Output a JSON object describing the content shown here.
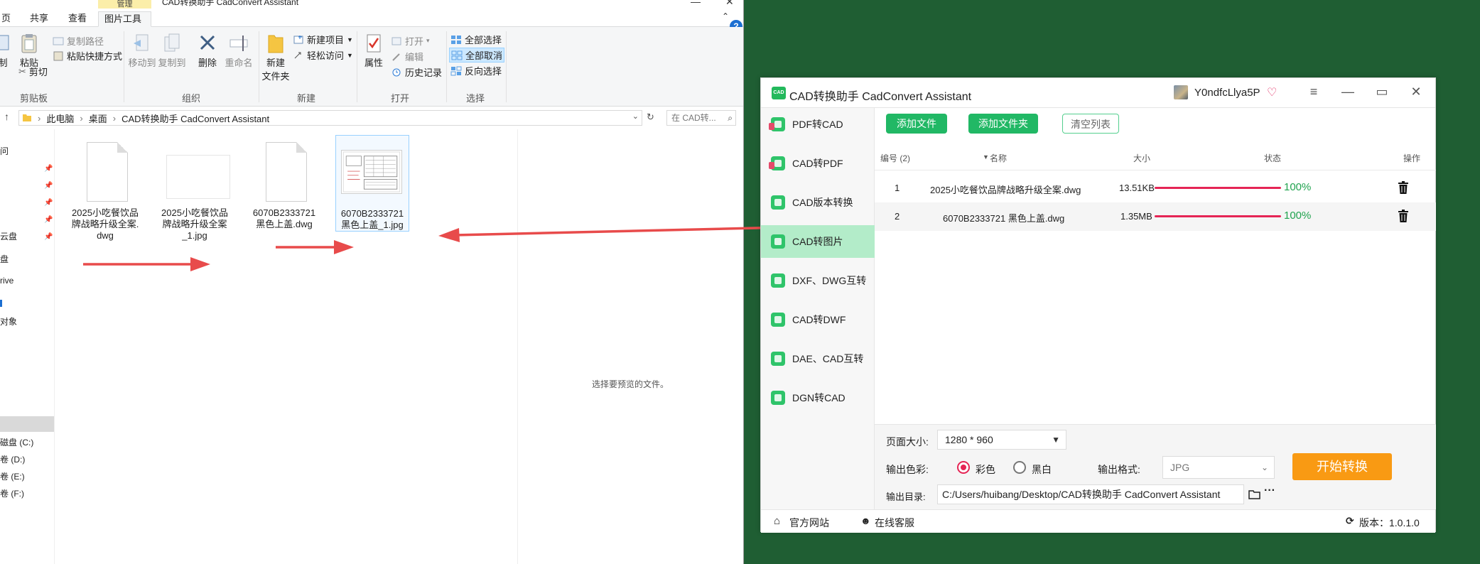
{
  "explorer": {
    "window_title": "CAD转换助手 CadConvert Assistant",
    "context_tab_header": "管理",
    "tabs": [
      "页",
      "共享",
      "查看",
      "图片工具"
    ],
    "ribbon": {
      "clipboard": {
        "copy_cut_partial": "制",
        "paste": "粘贴",
        "copy_path": "复制路径",
        "paste_shortcut": "粘贴快捷方式",
        "cut": "剪切",
        "group": "剪贴板"
      },
      "organize": {
        "move_to": "移动到",
        "copy_to": "复制到",
        "delete": "删除",
        "rename": "重命名",
        "group": "组织"
      },
      "new": {
        "new_folder_l1": "新建",
        "new_folder_l2": "文件夹",
        "new_item": "新建项目",
        "easy_access": "轻松访问",
        "group": "新建"
      },
      "open": {
        "properties": "属性",
        "open": "打开",
        "edit": "编辑",
        "history": "历史记录",
        "group": "打开"
      },
      "select": {
        "select_all": "全部选择",
        "select_none": "全部取消",
        "invert": "反向选择",
        "group": "选择"
      }
    },
    "address": {
      "crumb1": "此电脑",
      "crumb2": "桌面",
      "crumb3": "CAD转换助手 CadConvert Assistant"
    },
    "search_placeholder": "在 CAD转...",
    "nav_items": [
      "问",
      "云盘",
      "盘",
      "rive",
      "",
      "对象",
      "磁盘 (C:)",
      "卷 (D:)",
      "卷 (E:)",
      "卷 (F:)"
    ],
    "files": [
      {
        "l1": "2025小吃餐饮品",
        "l2": "牌战略升级全案.",
        "l3": "dwg"
      },
      {
        "l1": "2025小吃餐饮品",
        "l2": "牌战略升级全案",
        "l3": "_1.jpg"
      },
      {
        "l1": "6070B2333721",
        "l2": "黑色上盖.dwg",
        "l3": ""
      },
      {
        "l1": "6070B2333721",
        "l2": "黑色上盖_1.jpg",
        "l3": ""
      }
    ],
    "preview_message": "选择要预览的文件。"
  },
  "app": {
    "title": "CAD转换助手 CadConvert Assistant",
    "logo_text": "CAD",
    "user_name": "Y0ndfcLlya5P",
    "sidebar": [
      {
        "label": "PDF转CAD"
      },
      {
        "label": "CAD转PDF"
      },
      {
        "label": "CAD版本转换"
      },
      {
        "label": "CAD转图片"
      },
      {
        "label": "DXF、DWG互转"
      },
      {
        "label": "CAD转DWF"
      },
      {
        "label": "DAE、CAD互转"
      },
      {
        "label": "DGN转CAD"
      }
    ],
    "active_sidebar_index": 3,
    "toolbar": {
      "add_file": "添加文件",
      "add_folder": "添加文件夹",
      "clear_list": "清空列表"
    },
    "table": {
      "headers": {
        "num": "编号 (2)",
        "name": "名称",
        "size": "大小",
        "status": "状态",
        "action": "操作"
      },
      "rows": [
        {
          "num": "1",
          "name": "2025小吃餐饮品牌战略升级全案.dwg",
          "size": "13.51KB",
          "progress": "100%"
        },
        {
          "num": "2",
          "name": "6070B2333721 黑色上盖.dwg",
          "size": "1.35MB",
          "progress": "100%"
        }
      ]
    },
    "options": {
      "page_size_label": "页面大小:",
      "page_size_value": "1280 * 960",
      "color_label": "输出色彩:",
      "color_option": "彩色",
      "bw_option": "黑白",
      "format_label": "输出格式:",
      "format_value": "JPG",
      "outdir_label": "输出目录:",
      "outdir_value": "C:/Users/huibang/Desktop/CAD转换助手 CadConvert Assistant",
      "start_button": "开始转换"
    },
    "footer": {
      "website": "官方网站",
      "support": "在线客服",
      "version": "版本：1.0.1.0"
    }
  },
  "colors": {
    "accent_green": "#21b865",
    "progress_red": "#e52555",
    "start_orange": "#f99a13",
    "desktop_green": "#1f5e33",
    "arrow_red": "#e84b4b"
  }
}
